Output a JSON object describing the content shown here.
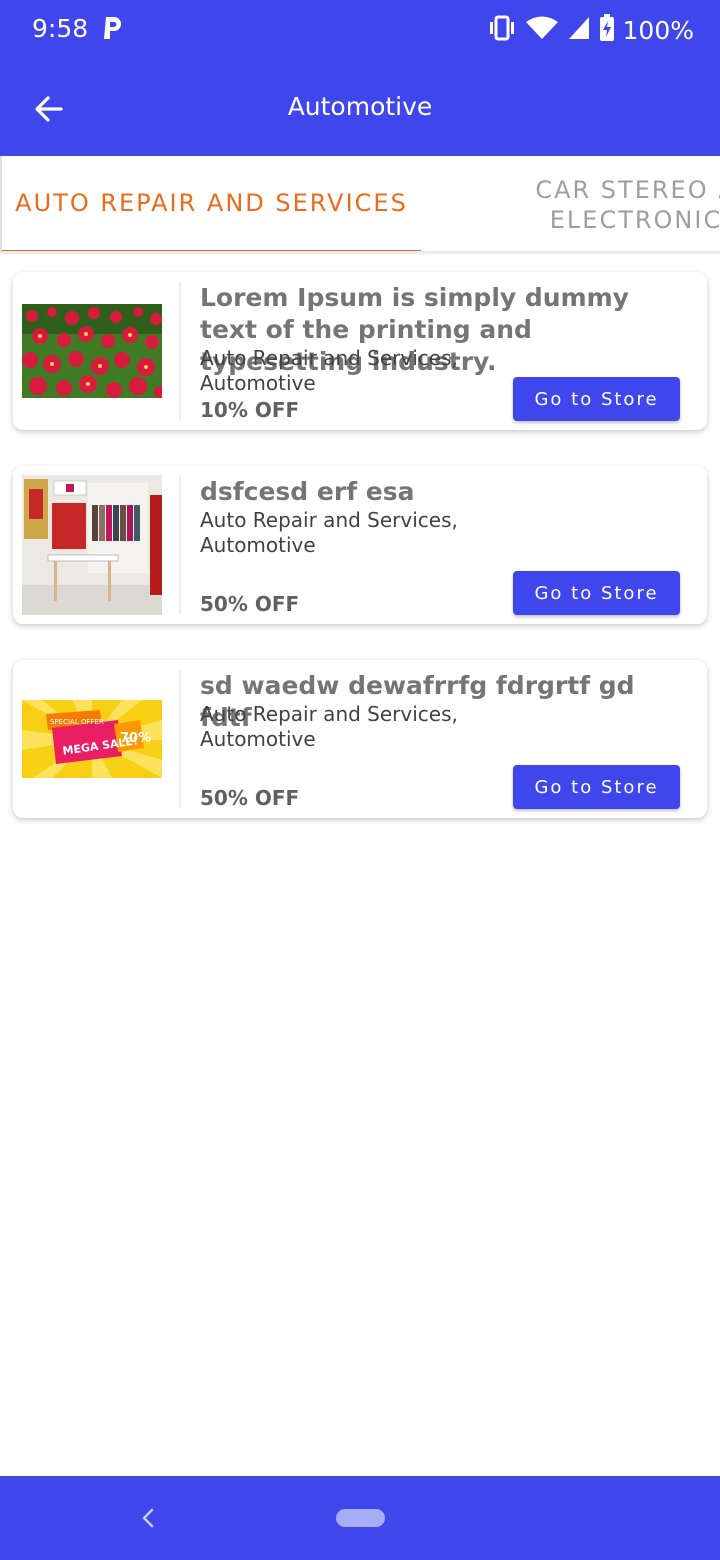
{
  "status_bar": {
    "time": "9:58",
    "battery": "100%",
    "icons": [
      "parking-icon",
      "vibrate-icon",
      "wifi-icon",
      "signal-icon",
      "battery-charging-icon"
    ]
  },
  "app_bar": {
    "title": "Automotive",
    "back_icon": "arrow-left-icon",
    "background": "#3f46ec"
  },
  "tabs": [
    {
      "label": "AUTO REPAIR AND SERVICES",
      "selected": true
    },
    {
      "label": "CAR STEREO A\nELECTRONIC",
      "selected": false
    }
  ],
  "accent_color": "#ee6a1c",
  "offers": [
    {
      "title": "Lorem Ipsum is simply dummy text of the printing and typesetting industry.",
      "category": "Auto Repair and Services, Automotive",
      "discount": "10% OFF",
      "button": "Go to Store",
      "image": "red-flowers-image"
    },
    {
      "title": "dsfcesd erf esa",
      "category": "Auto Repair and Services, Automotive",
      "discount": "50% OFF",
      "button": "Go to Store",
      "image": "clothing-store-image"
    },
    {
      "title": "sd waedw dewafrrfg fdrgrtf gd fdtf",
      "category": "Auto Repair and Services, Automotive",
      "discount": "50% OFF",
      "button": "Go to Store",
      "image": "mega-sale-banner-image",
      "image_text": {
        "tag": "SPECIAL OFFER",
        "main": "MEGA SALE!",
        "percent": "70%"
      }
    }
  ],
  "nav_bar": {
    "icons": [
      "nav-back-icon",
      "home-pill-icon"
    ]
  }
}
